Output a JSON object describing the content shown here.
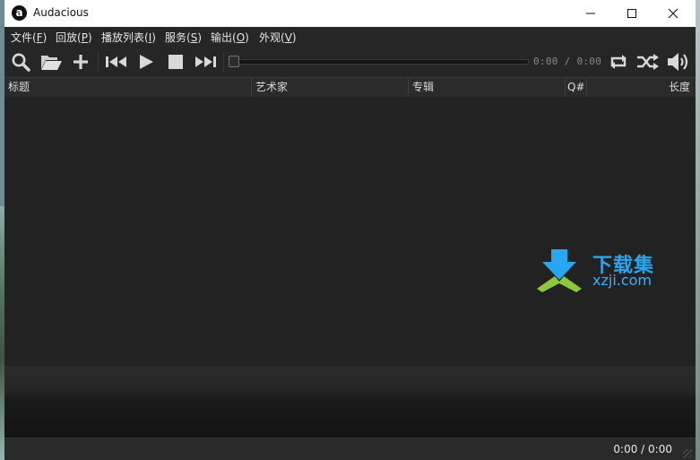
{
  "window": {
    "title": "Audacious"
  },
  "menu": [
    {
      "label": "文件(",
      "key": "F",
      "tail": ")"
    },
    {
      "label": "回放(",
      "key": "P",
      "tail": ")"
    },
    {
      "label": "播放列表(",
      "key": "I",
      "tail": ")"
    },
    {
      "label": "服务(",
      "key": "S",
      "tail": ")"
    },
    {
      "label": "输出(",
      "key": "O",
      "tail": ")"
    },
    {
      "label": "外观(",
      "key": "V",
      "tail": ")"
    }
  ],
  "toolbar": {
    "icons": [
      "search-icon",
      "open-folder-icon",
      "add-icon",
      "previous-track-icon",
      "play-icon",
      "stop-icon",
      "next-track-icon",
      "repeat-icon",
      "shuffle-icon",
      "volume-icon"
    ],
    "time": "0:00 / 0:00",
    "seek_position": 0
  },
  "columns": [
    "标题",
    "艺术家",
    "专辑",
    "Q#",
    "长度"
  ],
  "status": {
    "time": "0:00 / 0:00"
  },
  "watermark": {
    "cn": "下载集",
    "en": "xzji.com"
  },
  "colors": {
    "background": "#222222",
    "titlebar": "#ffffff",
    "text": "#e6e6e6",
    "watermark_blue": "#2aa5f0",
    "watermark_green": "#8cc63f"
  }
}
